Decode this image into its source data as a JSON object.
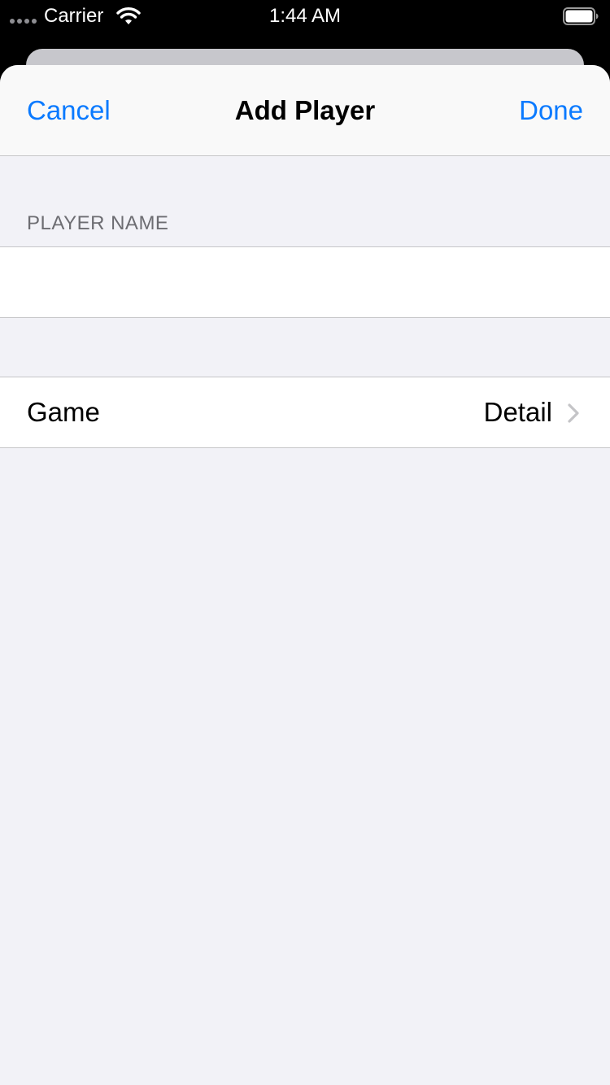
{
  "status_bar": {
    "carrier": "Carrier",
    "time": "1:44 AM",
    "icons": [
      "signal-dots-icon",
      "wifi-icon",
      "battery-icon"
    ]
  },
  "nav": {
    "cancel_label": "Cancel",
    "title": "Add Player",
    "done_label": "Done"
  },
  "form": {
    "player_name_header": "PLAYER NAME",
    "player_name_value": "",
    "game_label": "Game",
    "game_detail": "Detail"
  },
  "colors": {
    "accent": "#0a7aff",
    "background": "#f2f2f7",
    "separator": "#c6c6c8",
    "section_header": "#6d6d72"
  }
}
